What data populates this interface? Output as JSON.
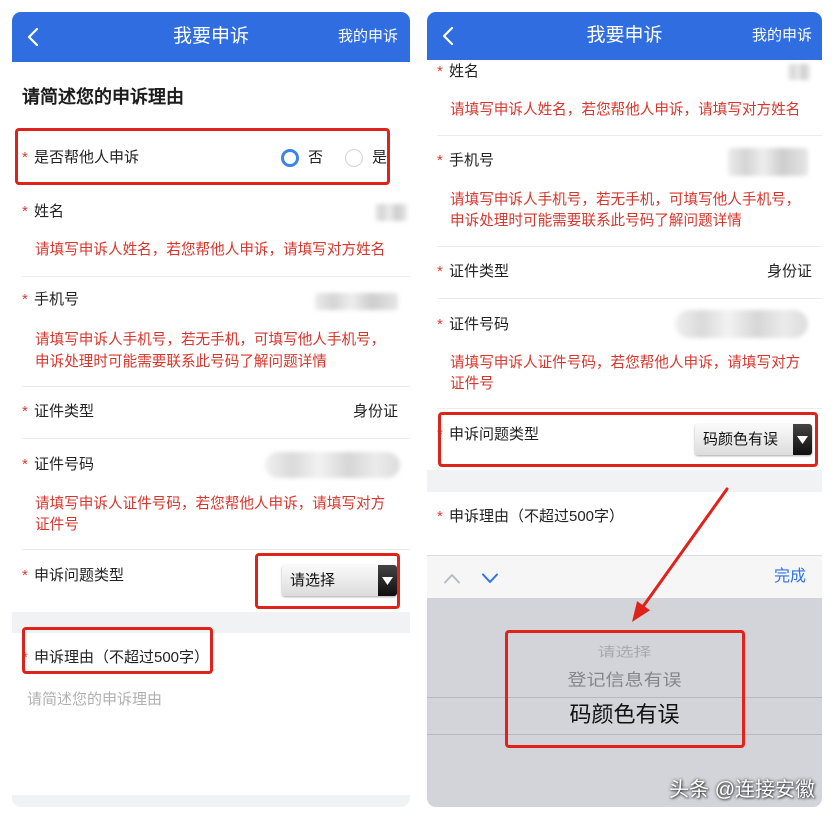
{
  "colors": {
    "header_blue": "#2f6de1",
    "required_red": "#e03a2f",
    "hint_red": "#d8352c",
    "annotation_red": "#e0231a",
    "accent_blue": "#2e73e8",
    "radio_blue": "#3b84ea"
  },
  "required_mark": "*",
  "screens": [
    {
      "header": {
        "back_icon": "chevron-left-icon",
        "title": "我要申诉",
        "my_appeals_link": "我的申诉"
      },
      "section_title": "请简述您的申诉理由",
      "help_others": {
        "label": "是否帮他人申诉",
        "options": [
          {
            "label": "否",
            "selected": true
          },
          {
            "label": "是",
            "selected": false
          }
        ]
      },
      "name": {
        "label": "姓名",
        "hint_lines": [
          "请填写申诉人姓名，若您帮他人申诉，请填写对方姓名"
        ]
      },
      "phone": {
        "label": "手机号",
        "hint_lines": [
          "请填写申诉人手机号，若无手机，可填写他人手机号，",
          "申诉处理时可能需要联系此号码了解问题详情"
        ]
      },
      "id_type": {
        "label": "证件类型",
        "value": "身份证"
      },
      "id_number": {
        "label": "证件号码",
        "hint_lines": [
          "请填写申诉人证件号码，若您帮他人申诉，请填写对方",
          "证件号"
        ]
      },
      "issue_type": {
        "label": "申诉问题类型",
        "selected": "请选择",
        "dropdown_icon": "triangle-down-icon"
      },
      "reason": {
        "label": "申诉理由（不超过500字）",
        "placeholder": "请简述您的申诉理由"
      }
    },
    {
      "header": {
        "back_icon": "chevron-left-icon",
        "title": "我要申诉",
        "my_appeals_link": "我的申诉"
      },
      "name": {
        "label": "姓名",
        "hint_lines": [
          "请填写申诉人姓名，若您帮他人申诉，请填写对方姓名"
        ]
      },
      "phone": {
        "label": "手机号",
        "hint_lines": [
          "请填写申诉人手机号，若无手机，可填写他人手机号，",
          "申诉处理时可能需要联系此号码了解问题详情"
        ]
      },
      "id_type": {
        "label": "证件类型",
        "value": "身份证"
      },
      "id_number": {
        "label": "证件号码",
        "hint_lines": [
          "请填写申诉人证件号码，若您帮他人申诉，请填写对方",
          "证件号"
        ]
      },
      "issue_type": {
        "label": "申诉问题类型",
        "selected": "码颜色有误",
        "dropdown_icon": "triangle-down-icon"
      },
      "reason": {
        "label": "申诉理由（不超过500字）"
      },
      "picker_toolbar": {
        "prev_icon": "chevron-up-icon",
        "next_icon": "chevron-down-icon",
        "done_label": "完成"
      },
      "picker": {
        "options": [
          {
            "label": "请选择",
            "selected": false
          },
          {
            "label": "登记信息有误",
            "selected": false
          },
          {
            "label": "码颜色有误",
            "selected": true
          }
        ]
      }
    }
  ],
  "watermark": "头条 @连接安徽"
}
